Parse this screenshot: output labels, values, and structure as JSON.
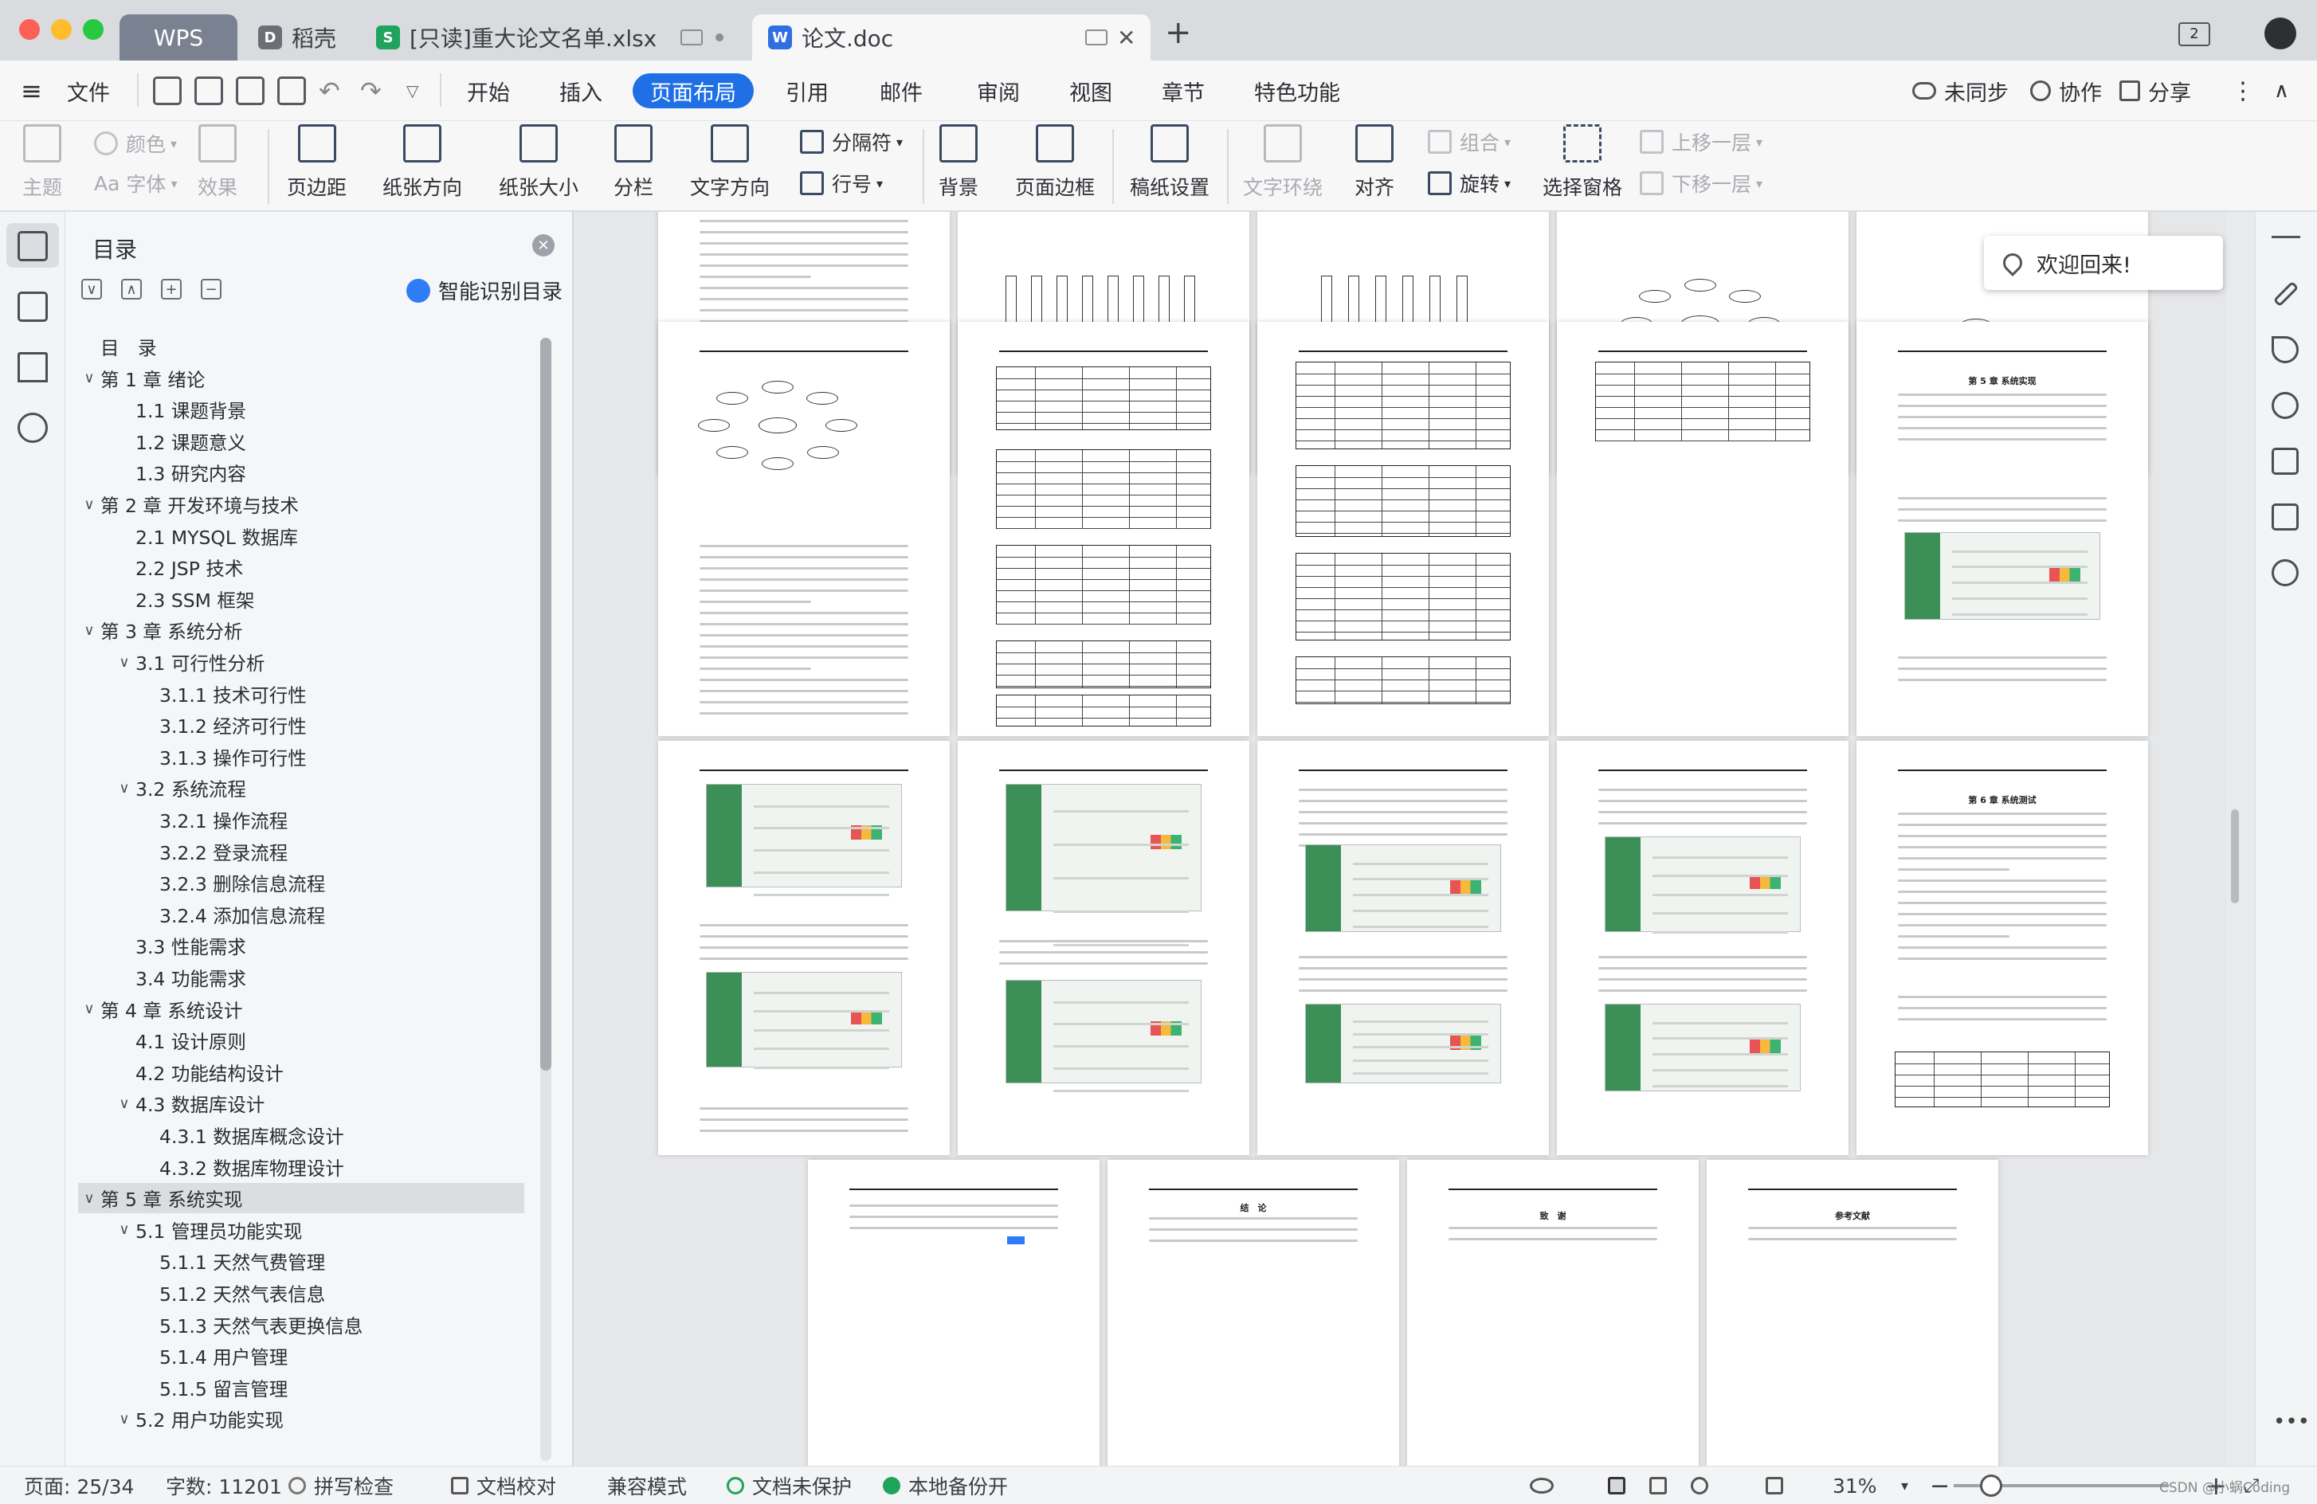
{
  "window": {
    "tabs": [
      {
        "label": "WPS"
      },
      {
        "label": "稻壳"
      },
      {
        "label": "[只读]重大论文名单.xlsx"
      },
      {
        "label": "论文.doc"
      }
    ],
    "new_tab": "+",
    "window_badge": "2",
    "traffic_colors": {
      "close": "#fe5f57",
      "min": "#febc2e",
      "max": "#28c840"
    }
  },
  "menubar": {
    "hamburger_label": "文件",
    "items": [
      "开始",
      "插入",
      "页面布局",
      "引用",
      "邮件",
      "审阅",
      "视图",
      "章节",
      "特色功能"
    ],
    "active": "页面布局",
    "accent": "#1f6fe5",
    "right": [
      "未同步",
      "协作",
      "分享"
    ]
  },
  "ribbon": {
    "theme": "主题",
    "color": "颜色",
    "font": "字体",
    "effect": "效果",
    "margins": "页边距",
    "orientation": "纸张方向",
    "size": "纸张大小",
    "columns": "分栏",
    "text_direction": "文字方向",
    "hyphenation": "分隔符",
    "line_numbers": "行号",
    "background": "背景",
    "page_border": "页面边框",
    "grid_paper": "稿纸设置",
    "wrap_text": "文字环绕",
    "align": "对齐",
    "group": "组合",
    "rotate": "旋转",
    "selection_pane": "选择窗格",
    "bring_forward": "上移一层",
    "send_backward": "下移一层"
  },
  "toc": {
    "title": "目录",
    "smart": "智能识别目录",
    "items": [
      {
        "label": "目　录",
        "level": 0,
        "chev": ""
      },
      {
        "label": "第 1 章  绪论",
        "level": 0,
        "chev": "∨"
      },
      {
        "label": "1.1  课题背景",
        "level": 1,
        "chev": ""
      },
      {
        "label": "1.2  课题意义",
        "level": 1,
        "chev": ""
      },
      {
        "label": "1.3  研究内容",
        "level": 1,
        "chev": ""
      },
      {
        "label": "第 2 章  开发环境与技术",
        "level": 0,
        "chev": "∨"
      },
      {
        "label": "2.1 MYSQL 数据库",
        "level": 1,
        "chev": ""
      },
      {
        "label": "2.2 JSP 技术",
        "level": 1,
        "chev": ""
      },
      {
        "label": "2.3 SSM 框架",
        "level": 1,
        "chev": ""
      },
      {
        "label": "第 3 章  系统分析",
        "level": 0,
        "chev": "∨"
      },
      {
        "label": "3.1  可行性分析",
        "level": 1,
        "chev": "∨"
      },
      {
        "label": "3.1.1  技术可行性",
        "level": 2,
        "chev": ""
      },
      {
        "label": "3.1.2  经济可行性",
        "level": 2,
        "chev": ""
      },
      {
        "label": "3.1.3  操作可行性",
        "level": 2,
        "chev": ""
      },
      {
        "label": "3.2  系统流程",
        "level": 1,
        "chev": "∨"
      },
      {
        "label": "3.2.1  操作流程",
        "level": 2,
        "chev": ""
      },
      {
        "label": "3.2.2  登录流程",
        "level": 2,
        "chev": ""
      },
      {
        "label": "3.2.3  删除信息流程",
        "level": 2,
        "chev": ""
      },
      {
        "label": "3.2.4  添加信息流程",
        "level": 2,
        "chev": ""
      },
      {
        "label": "3.3  性能需求",
        "level": 1,
        "chev": ""
      },
      {
        "label": "3.4  功能需求",
        "level": 1,
        "chev": ""
      },
      {
        "label": "第 4 章  系统设计",
        "level": 0,
        "chev": "∨"
      },
      {
        "label": "4.1  设计原则",
        "level": 1,
        "chev": ""
      },
      {
        "label": "4.2  功能结构设计",
        "level": 1,
        "chev": ""
      },
      {
        "label": "4.3  数据库设计",
        "level": 1,
        "chev": "∨"
      },
      {
        "label": "4.3.1  数据库概念设计",
        "level": 2,
        "chev": ""
      },
      {
        "label": "4.3.2  数据库物理设计",
        "level": 2,
        "chev": ""
      },
      {
        "label": "第 5 章  系统实现",
        "level": 0,
        "chev": "∨"
      },
      {
        "label": "5.1  管理员功能实现",
        "level": 1,
        "chev": "∨"
      },
      {
        "label": "5.1.1  天然气费管理",
        "level": 2,
        "chev": ""
      },
      {
        "label": "5.1.2  天然气表信息",
        "level": 2,
        "chev": ""
      },
      {
        "label": "5.1.3  天然气表更换信息",
        "level": 2,
        "chev": ""
      },
      {
        "label": "5.1.4  用户管理",
        "level": 2,
        "chev": ""
      },
      {
        "label": "5.1.5  留言管理",
        "level": 2,
        "chev": ""
      },
      {
        "label": "5.2  用户功能实现",
        "level": 1,
        "chev": "∨"
      }
    ],
    "selected_index": 27
  },
  "document": {
    "page_headings": {
      "p11": "第 5 章 系统实现",
      "p21": "第 6 章 系统测试",
      "p32": "结　论",
      "p33": "致　谢",
      "p34": "参考文献"
    }
  },
  "welcome": "欢迎回来!",
  "status": {
    "page": "页面: 25/34",
    "words": "字数: 11201",
    "spell": "拼写检查",
    "proof": "文档校对",
    "compat": "兼容模式",
    "unprotected": "文档未保护",
    "backup": "本地备份开",
    "zoom": "31%",
    "zoom_value": 31,
    "watermark": "CSDN @小蜗Coding"
  }
}
